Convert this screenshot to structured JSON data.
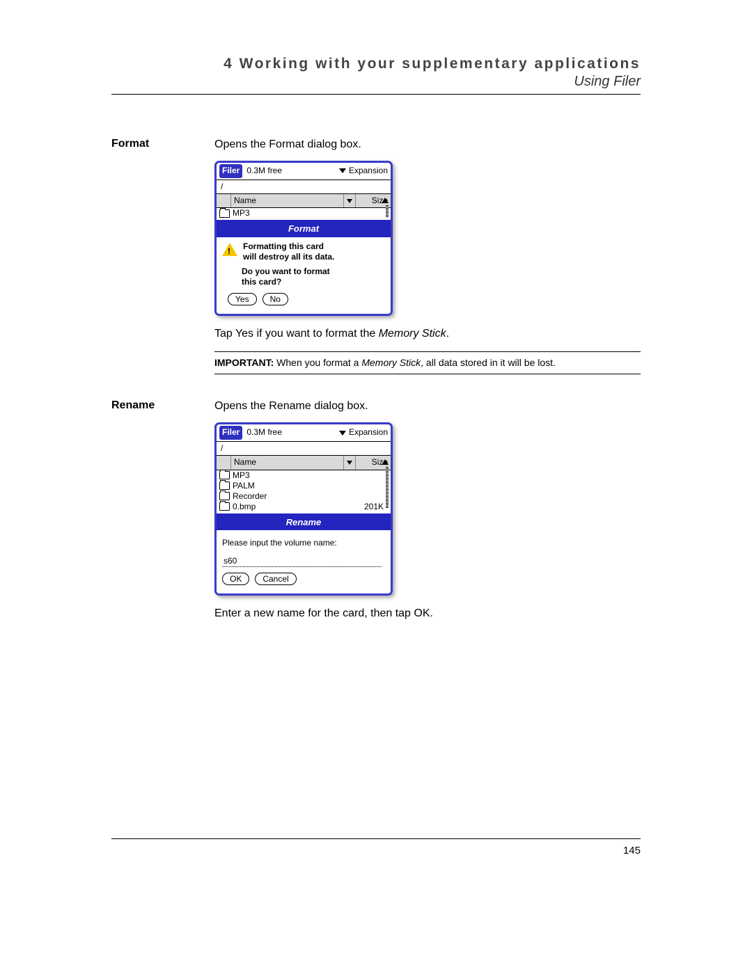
{
  "header": {
    "chapter": "4 Working with your supplementary applications",
    "section": "Using Filer"
  },
  "format": {
    "label": "Format",
    "desc": "Opens the Format dialog box.",
    "caption_prefix": "Tap Yes if you want to format the ",
    "caption_em": "Memory Stick",
    "caption_suffix": ".",
    "palm": {
      "app": "Filer",
      "free": "0.3M free",
      "dropdown": "Expansion",
      "path": "/",
      "col_name": "Name",
      "col_size": "Size",
      "rows": [
        {
          "name": "MP3",
          "size": ""
        }
      ],
      "dialog_title": "Format",
      "warn_line1": "Formatting this card",
      "warn_line2": "will destroy all its data.",
      "question_line1": "Do you want to format",
      "question_line2": "this card?",
      "btn_yes": "Yes",
      "btn_no": "No"
    }
  },
  "note": {
    "imp": "IMPORTANT:",
    "text_prefix": "  When you format a ",
    "text_em": "Memory Stick",
    "text_suffix": ", all data stored in it will be lost."
  },
  "rename": {
    "label": "Rename",
    "desc": "Opens the Rename dialog box.",
    "caption": "Enter a new name for the card, then tap OK.",
    "palm": {
      "app": "Filer",
      "free": "0.3M free",
      "dropdown": "Expansion",
      "path": "/",
      "col_name": "Name",
      "col_size": "Size",
      "rows": [
        {
          "name": "MP3",
          "size": ""
        },
        {
          "name": "PALM",
          "size": ""
        },
        {
          "name": "Recorder",
          "size": ""
        },
        {
          "name": "0.bmp",
          "size": "201K"
        }
      ],
      "dialog_title": "Rename",
      "input_label": "Please input the volume name:",
      "input_value": "s60",
      "btn_ok": "OK",
      "btn_cancel": "Cancel"
    }
  },
  "page_number": "145"
}
